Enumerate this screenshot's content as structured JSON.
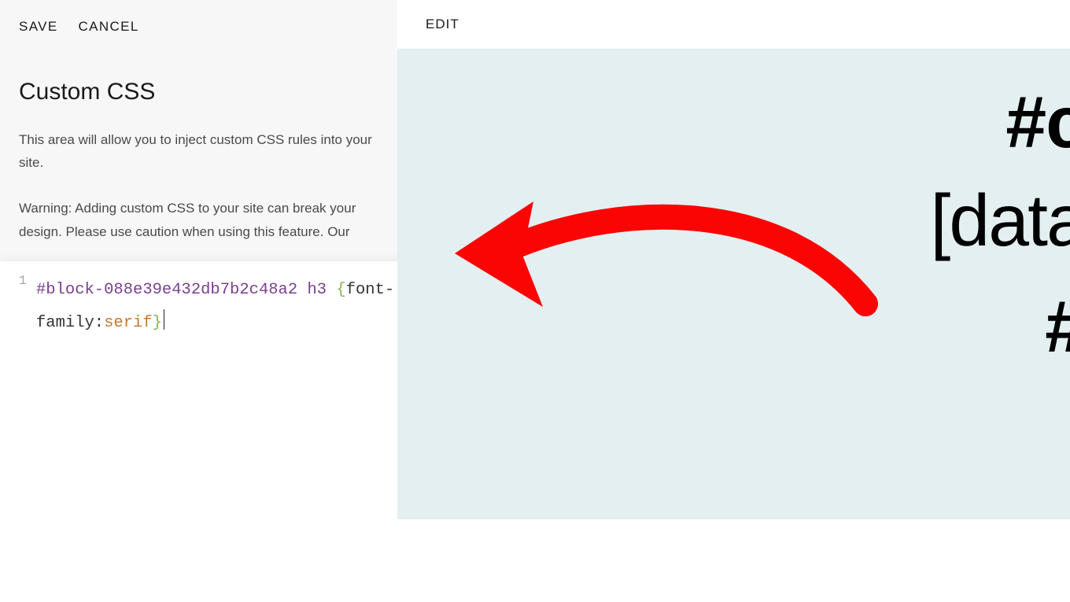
{
  "actions": {
    "save": "SAVE",
    "cancel": "CANCEL"
  },
  "panel": {
    "title": "Custom CSS",
    "description": "This area will allow you to inject custom CSS rules into your site.",
    "warning": "Warning: Adding custom CSS to your site can break your design. Please use caution when using this feature. Our"
  },
  "editor": {
    "line_number": "1",
    "selector": "#block-088e39e432db7b2c48a2 h3 ",
    "brace_open": "{",
    "prop1": "font-",
    "prop2": "family:",
    "value": "serif",
    "brace_close": "}"
  },
  "preview": {
    "edit": "EDIT",
    "text1": "#c",
    "text2": "[data",
    "text3": "#"
  }
}
